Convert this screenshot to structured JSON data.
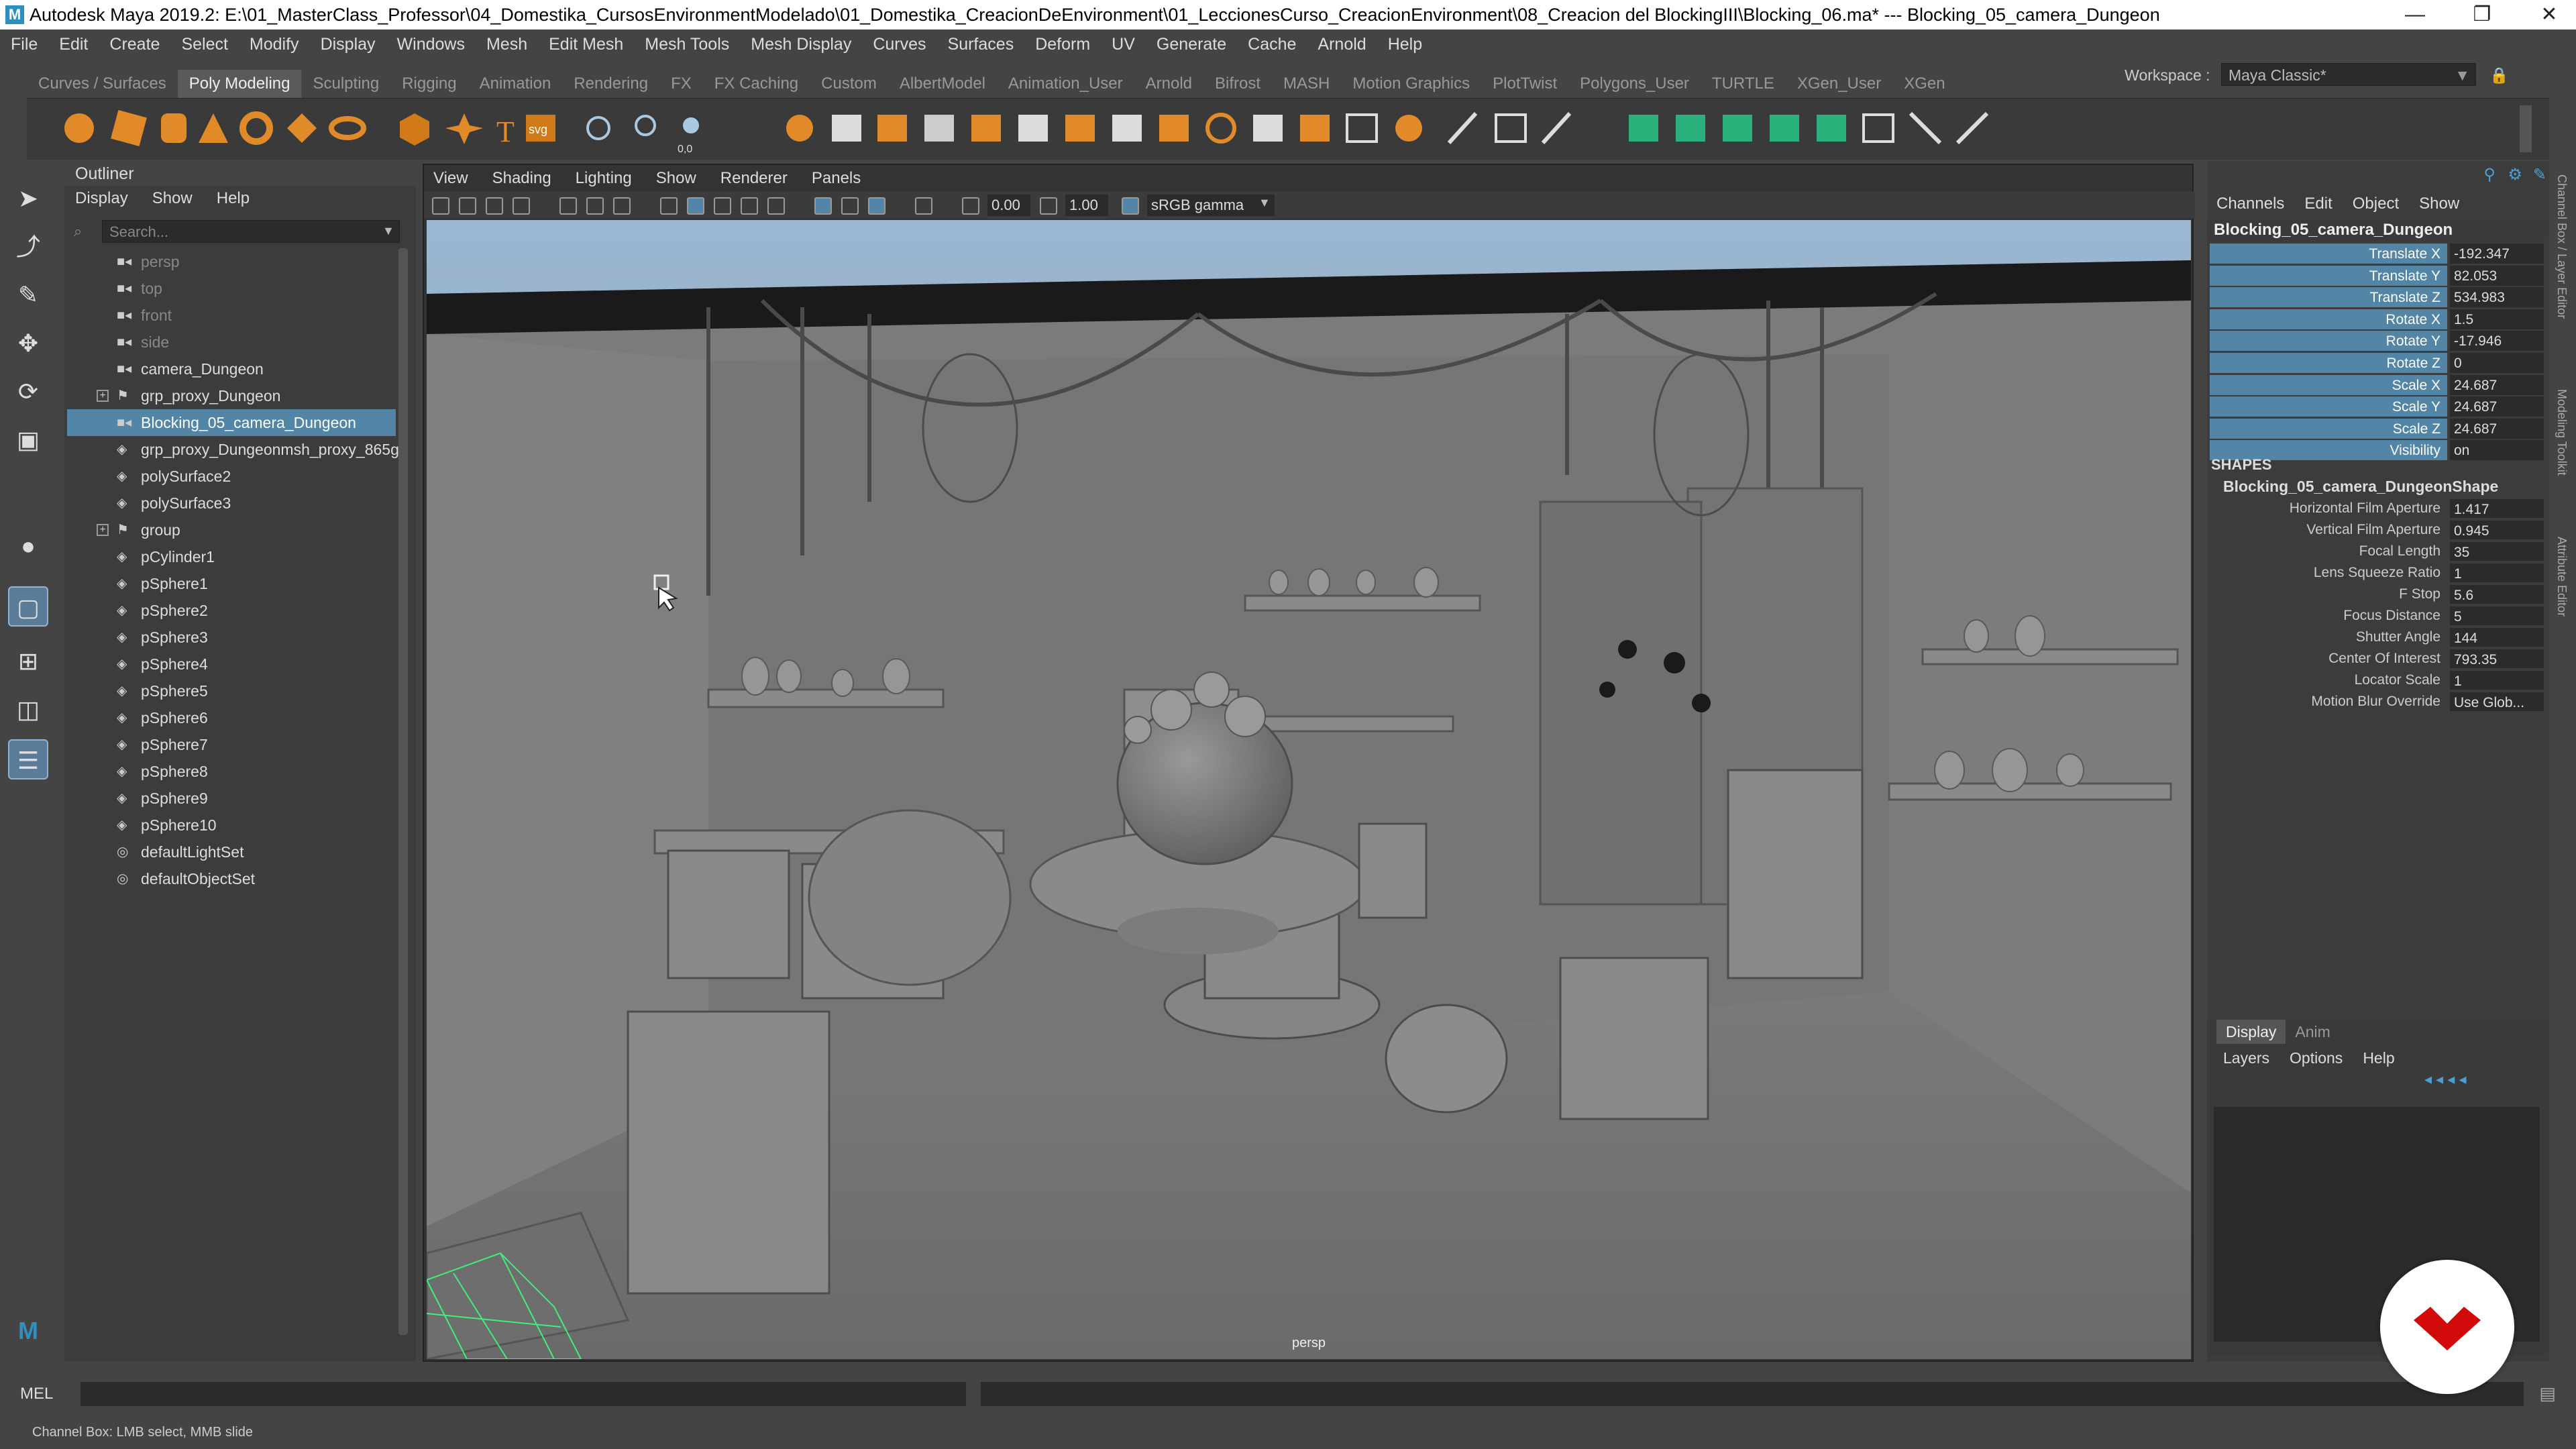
{
  "window": {
    "title": "Autodesk Maya 2019.2: E:\\01_MasterClass_Professor\\04_Domestika_CursosEnvironmentModelado\\01_Domestika_CreacionDeEnvironment\\01_LeccionesCurso_CreacionEnvironment\\08_Creacion del BlockingIII\\Blocking_06.ma*   ---   Blocking_05_camera_Dungeon",
    "logo": "M",
    "minimize": "—",
    "restore": "❐",
    "close": "✕"
  },
  "menubar": [
    "File",
    "Edit",
    "Create",
    "Select",
    "Modify",
    "Display",
    "Windows",
    "Mesh",
    "Edit Mesh",
    "Mesh Tools",
    "Mesh Display",
    "Curves",
    "Surfaces",
    "Deform",
    "UV",
    "Generate",
    "Cache",
    "Arnold",
    "Help"
  ],
  "workspace": {
    "label": "Workspace :",
    "value": "Maya Classic*"
  },
  "shelf_tabs": [
    "Curves / Surfaces",
    "Poly Modeling",
    "Sculpting",
    "Rigging",
    "Animation",
    "Rendering",
    "FX",
    "FX Caching",
    "Custom",
    "AlbertModel",
    "Animation_User",
    "Arnold",
    "Bifrost",
    "MASH",
    "Motion Graphics",
    "PlotTwist",
    "Polygons_User",
    "TURTLE",
    "XGen_User",
    "XGen"
  ],
  "shelf_active": "Poly Modeling",
  "shelf_text_icons": {
    "type": "T",
    "svg": "svg",
    "scale_text": "0,0"
  },
  "outliner": {
    "title": "Outliner",
    "menus": [
      "Display",
      "Show",
      "Help"
    ],
    "search_placeholder": "Search...",
    "items": [
      {
        "label": "persp",
        "icon": "camera-icon",
        "dim": true
      },
      {
        "label": "top",
        "icon": "camera-icon",
        "dim": true
      },
      {
        "label": "front",
        "icon": "camera-icon",
        "dim": true
      },
      {
        "label": "side",
        "icon": "camera-icon",
        "dim": true
      },
      {
        "label": "camera_Dungeon",
        "icon": "camera-icon"
      },
      {
        "label": "grp_proxy_Dungeon",
        "icon": "group-icon",
        "expandable": true
      },
      {
        "label": "Blocking_05_camera_Dungeon",
        "icon": "camera-icon",
        "selected": true
      },
      {
        "label": "grp_proxy_Dungeonmsh_proxy_865g",
        "icon": "mesh-icon"
      },
      {
        "label": "polySurface2",
        "icon": "mesh-icon"
      },
      {
        "label": "polySurface3",
        "icon": "mesh-icon"
      },
      {
        "label": "group",
        "icon": "group-icon",
        "expandable": true
      },
      {
        "label": "pCylinder1",
        "icon": "mesh-icon"
      },
      {
        "label": "pSphere1",
        "icon": "mesh-icon"
      },
      {
        "label": "pSphere2",
        "icon": "mesh-icon"
      },
      {
        "label": "pSphere3",
        "icon": "mesh-icon"
      },
      {
        "label": "pSphere4",
        "icon": "mesh-icon"
      },
      {
        "label": "pSphere5",
        "icon": "mesh-icon"
      },
      {
        "label": "pSphere6",
        "icon": "mesh-icon"
      },
      {
        "label": "pSphere7",
        "icon": "mesh-icon"
      },
      {
        "label": "pSphere8",
        "icon": "mesh-icon"
      },
      {
        "label": "pSphere9",
        "icon": "mesh-icon"
      },
      {
        "label": "pSphere10",
        "icon": "mesh-icon"
      },
      {
        "label": "defaultLightSet",
        "icon": "set-icon"
      },
      {
        "label": "defaultObjectSet",
        "icon": "set-icon"
      }
    ]
  },
  "viewport": {
    "menus": [
      "View",
      "Shading",
      "Lighting",
      "Show",
      "Renderer",
      "Panels"
    ],
    "exposure": "0.00",
    "gamma": "1.00",
    "color_space": "sRGB gamma",
    "camera_label": "persp"
  },
  "channel_box": {
    "menus": [
      "Channels",
      "Edit",
      "Object",
      "Show"
    ],
    "object_name": "Blocking_05_camera_Dungeon",
    "channels": [
      {
        "label": "Translate X",
        "value": "-192.347"
      },
      {
        "label": "Translate Y",
        "value": "82.053"
      },
      {
        "label": "Translate Z",
        "value": "534.983"
      },
      {
        "label": "Rotate X",
        "value": "1.5"
      },
      {
        "label": "Rotate Y",
        "value": "-17.946"
      },
      {
        "label": "Rotate Z",
        "value": "0"
      },
      {
        "label": "Scale X",
        "value": "24.687"
      },
      {
        "label": "Scale Y",
        "value": "24.687"
      },
      {
        "label": "Scale Z",
        "value": "24.687"
      },
      {
        "label": "Visibility",
        "value": "on"
      }
    ],
    "shapes_header": "SHAPES",
    "shape_name": "Blocking_05_camera_DungeonShape",
    "shape_attrs": [
      {
        "label": "Horizontal Film Aperture",
        "value": "1.417"
      },
      {
        "label": "Vertical Film Aperture",
        "value": "0.945"
      },
      {
        "label": "Focal Length",
        "value": "35"
      },
      {
        "label": "Lens Squeeze Ratio",
        "value": "1"
      },
      {
        "label": "F Stop",
        "value": "5.6"
      },
      {
        "label": "Focus Distance",
        "value": "5"
      },
      {
        "label": "Shutter Angle",
        "value": "144"
      },
      {
        "label": "Center Of Interest",
        "value": "793.35"
      },
      {
        "label": "Locator Scale",
        "value": "1"
      },
      {
        "label": "Motion Blur Override",
        "value": "Use Glob..."
      }
    ]
  },
  "layer_editor": {
    "tabs": [
      "Display",
      "Anim"
    ],
    "active_tab": "Display",
    "menus": [
      "Layers",
      "Options",
      "Help"
    ]
  },
  "side_labels": [
    "Channel Box / Layer Editor",
    "Modeling Toolkit",
    "Attribute Editor"
  ],
  "command_line": {
    "label": "MEL"
  },
  "help_line": "Channel Box: LMB select, MMB slide",
  "colors": {
    "selection": "#5285a6",
    "background": "#444444",
    "field": "#2b2b2b",
    "brand_badge": "#d20a0a"
  }
}
